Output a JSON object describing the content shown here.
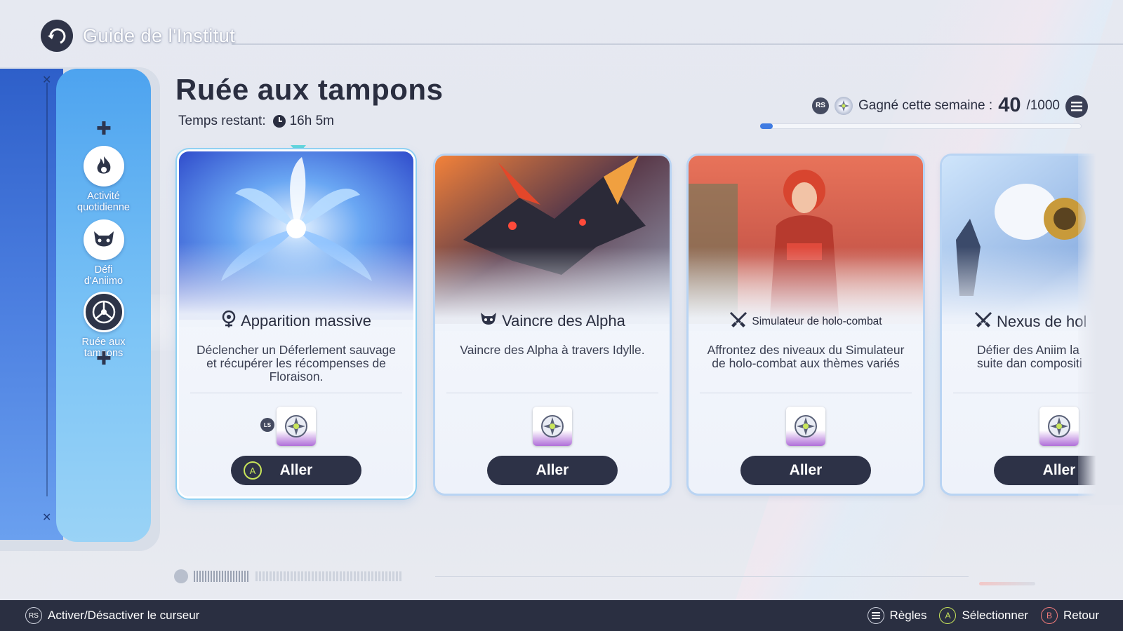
{
  "header": {
    "title": "Guide de l'Institut"
  },
  "sidebar": {
    "items": [
      {
        "label": "Activité\nquotidienne",
        "icon": "flame-icon"
      },
      {
        "label": "Défi\nd'Aniimo",
        "icon": "beast-face-icon"
      },
      {
        "label": "Ruée aux\ntampons",
        "icon": "stamp-icon",
        "active": true
      }
    ]
  },
  "main": {
    "title": "Ruée aux tampons",
    "time_label": "Temps restant:",
    "time_value": "16h 5m",
    "weekly": {
      "rs": "RS",
      "label": "Gagné cette semaine :",
      "count": "40",
      "max": "/1000",
      "progress_fraction": 0.04
    }
  },
  "cards": [
    {
      "title": "Apparition massive",
      "icon": "bloom-icon",
      "desc": "Déclencher un Déferlement sauvage et récupérer les récompenses de Floraison.",
      "button": "Aller",
      "button_key": "A",
      "ls": "LS",
      "selected": true
    },
    {
      "title": "Vaincre des Alpha",
      "icon": "horned-mask-icon",
      "desc": "Vaincre des Alpha à travers Idylle.",
      "button": "Aller"
    },
    {
      "title": "Simulateur de holo-combat",
      "icon": "crossed-swords-icon",
      "desc": "Affrontez des niveaux du Simulateur de holo-combat aux thèmes variés",
      "button": "Aller"
    },
    {
      "title": "Nexus de hol",
      "icon": "crossed-swords-icon",
      "desc": "Défier des Aniim la suite dan compositi",
      "button": "Aller"
    }
  ],
  "footer": {
    "toggle_cursor": "Activer/Désactiver le curseur",
    "toggle_key": "RS",
    "rules": "Règles",
    "select": "Sélectionner",
    "select_key": "A",
    "back": "Retour",
    "back_key": "B"
  },
  "colors": {
    "accent": "#3f7be2",
    "dark": "#2d3247",
    "nav_blue": "#4da3ef",
    "select_cyan": "#62d5dc"
  }
}
